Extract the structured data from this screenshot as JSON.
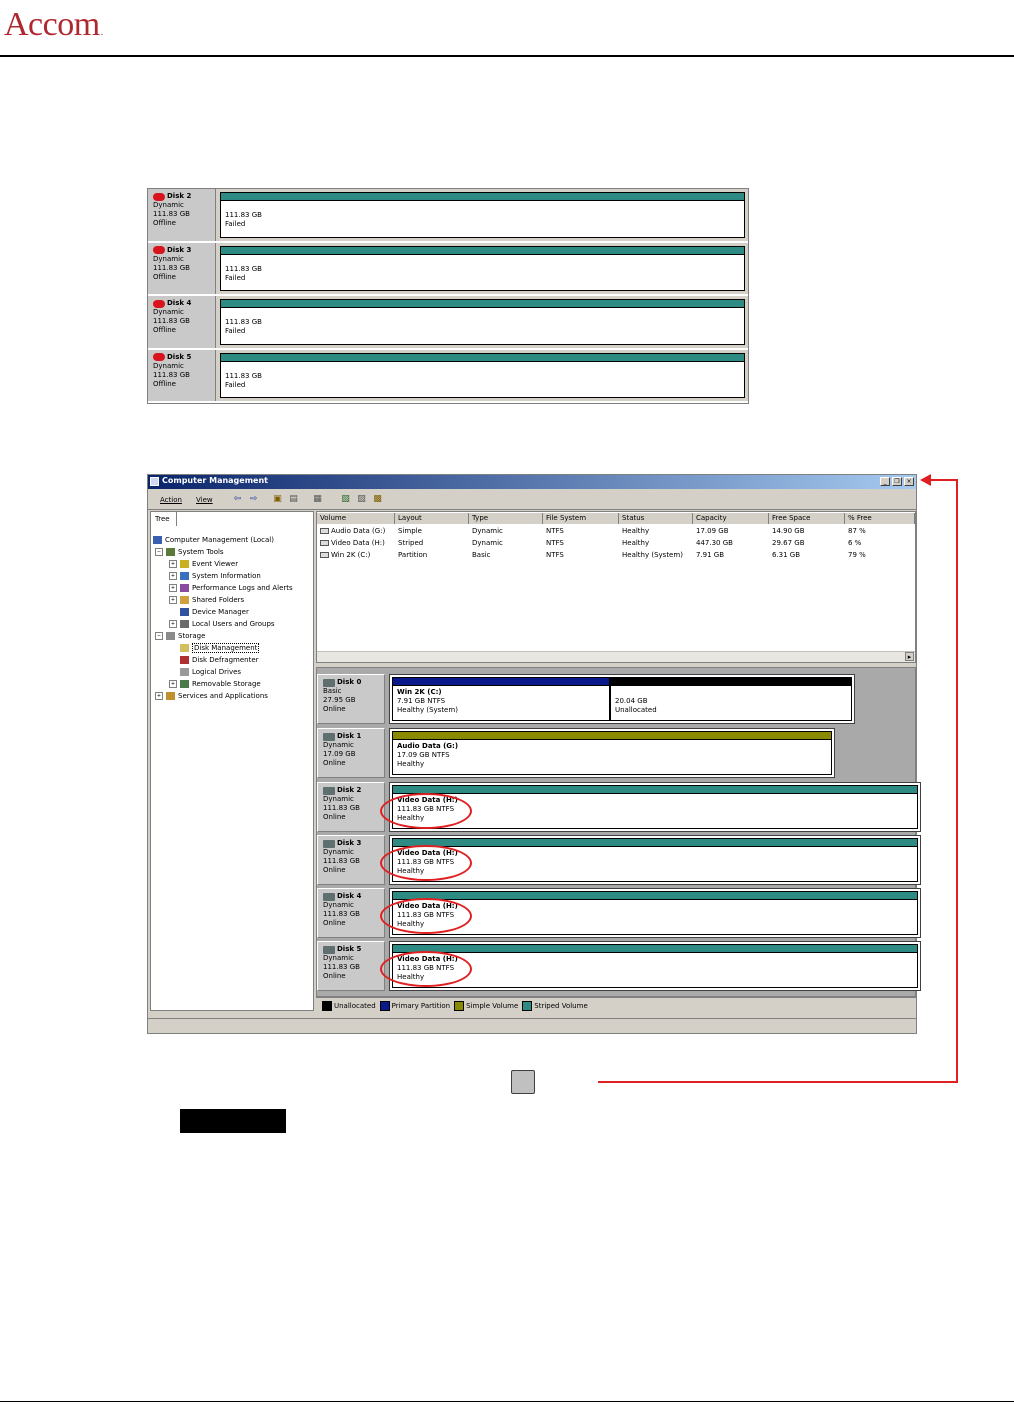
{
  "header": {
    "logo_text": "Accom",
    "logo_mark": "."
  },
  "top_panel": {
    "disks": [
      {
        "name": "Disk 2",
        "type": "Dynamic",
        "size": "111.83 GB",
        "status": "Offline",
        "vol_size": "111.83 GB",
        "vol_status": "Failed"
      },
      {
        "name": "Disk 3",
        "type": "Dynamic",
        "size": "111.83 GB",
        "status": "Offline",
        "vol_size": "111.83 GB",
        "vol_status": "Failed"
      },
      {
        "name": "Disk 4",
        "type": "Dynamic",
        "size": "111.83 GB",
        "status": "Offline",
        "vol_size": "111.83 GB",
        "vol_status": "Failed"
      },
      {
        "name": "Disk 5",
        "type": "Dynamic",
        "size": "111.83 GB",
        "status": "Offline",
        "vol_size": "111.83 GB",
        "vol_status": "Failed"
      }
    ]
  },
  "window": {
    "title": "Computer Management",
    "menu": {
      "action": "Action",
      "view": "View"
    },
    "tree_tab": "Tree",
    "tree": [
      {
        "label": "Computer Management (Local)",
        "level": 0
      },
      {
        "label": "System Tools",
        "level": 1
      },
      {
        "label": "Event Viewer",
        "level": 2
      },
      {
        "label": "System Information",
        "level": 2
      },
      {
        "label": "Performance Logs and Alerts",
        "level": 2
      },
      {
        "label": "Shared Folders",
        "level": 2
      },
      {
        "label": "Device Manager",
        "level": 2
      },
      {
        "label": "Local Users and Groups",
        "level": 2
      },
      {
        "label": "Storage",
        "level": 1
      },
      {
        "label": "Disk Management",
        "level": 2
      },
      {
        "label": "Disk Defragmenter",
        "level": 2
      },
      {
        "label": "Logical Drives",
        "level": 2
      },
      {
        "label": "Removable Storage",
        "level": 2
      },
      {
        "label": "Services and Applications",
        "level": 1
      }
    ],
    "columns": [
      "Volume",
      "Layout",
      "Type",
      "File System",
      "Status",
      "Capacity",
      "Free Space",
      "% Free"
    ],
    "volumes": [
      [
        "Audio Data (G:)",
        "Simple",
        "Dynamic",
        "NTFS",
        "Healthy",
        "17.09 GB",
        "14.90 GB",
        "87 %"
      ],
      [
        "Video Data (H:)",
        "Striped",
        "Dynamic",
        "NTFS",
        "Healthy",
        "447.30 GB",
        "29.67 GB",
        "6 %"
      ],
      [
        "Win 2K (C:)",
        "Partition",
        "Basic",
        "NTFS",
        "Healthy (System)",
        "7.91 GB",
        "6.31 GB",
        "79 %"
      ]
    ],
    "disks": [
      {
        "name": "Disk 0",
        "type": "Basic",
        "size": "27.95 GB",
        "status": "Online",
        "vols": [
          {
            "title": "Win 2K (C:)",
            "size": "7.91 GB NTFS",
            "status": "Healthy (System)",
            "color": "#0a1a8a"
          },
          {
            "title": "",
            "size": "20.04 GB",
            "status": "Unallocated",
            "color": "#000000"
          }
        ]
      },
      {
        "name": "Disk 1",
        "type": "Dynamic",
        "size": "17.09 GB",
        "status": "Online",
        "vols": [
          {
            "title": "Audio Data (G:)",
            "size": "17.09 GB NTFS",
            "status": "Healthy",
            "color": "#8a8a00"
          }
        ]
      },
      {
        "name": "Disk 2",
        "type": "Dynamic",
        "size": "111.83 GB",
        "status": "Online",
        "vols": [
          {
            "title": "Video Data (H:)",
            "size": "111.83 GB NTFS",
            "status": "Healthy",
            "color": "#2e8b83"
          }
        ]
      },
      {
        "name": "Disk 3",
        "type": "Dynamic",
        "size": "111.83 GB",
        "status": "Online",
        "vols": [
          {
            "title": "Video Data (H:)",
            "size": "111.83 GB NTFS",
            "status": "Healthy",
            "color": "#2e8b83"
          }
        ]
      },
      {
        "name": "Disk 4",
        "type": "Dynamic",
        "size": "111.83 GB",
        "status": "Online",
        "vols": [
          {
            "title": "Video Data (H:)",
            "size": "111.83 GB NTFS",
            "status": "Healthy",
            "color": "#2e8b83"
          }
        ]
      },
      {
        "name": "Disk 5",
        "type": "Dynamic",
        "size": "111.83 GB",
        "status": "Online",
        "vols": [
          {
            "title": "Video Data (H:)",
            "size": "111.83 GB NTFS",
            "status": "Healthy",
            "color": "#2e8b83"
          }
        ]
      }
    ],
    "legend": [
      {
        "label": "Unallocated",
        "color": "#000000"
      },
      {
        "label": "Primary Partition",
        "color": "#0a1a8a"
      },
      {
        "label": "Simple Volume",
        "color": "#8a8a00"
      },
      {
        "label": "Striped Volume",
        "color": "#2e8b83"
      }
    ]
  },
  "colors": {
    "brand": "#b0282f",
    "highlight": "#e02020",
    "striped": "#2e8b83"
  }
}
